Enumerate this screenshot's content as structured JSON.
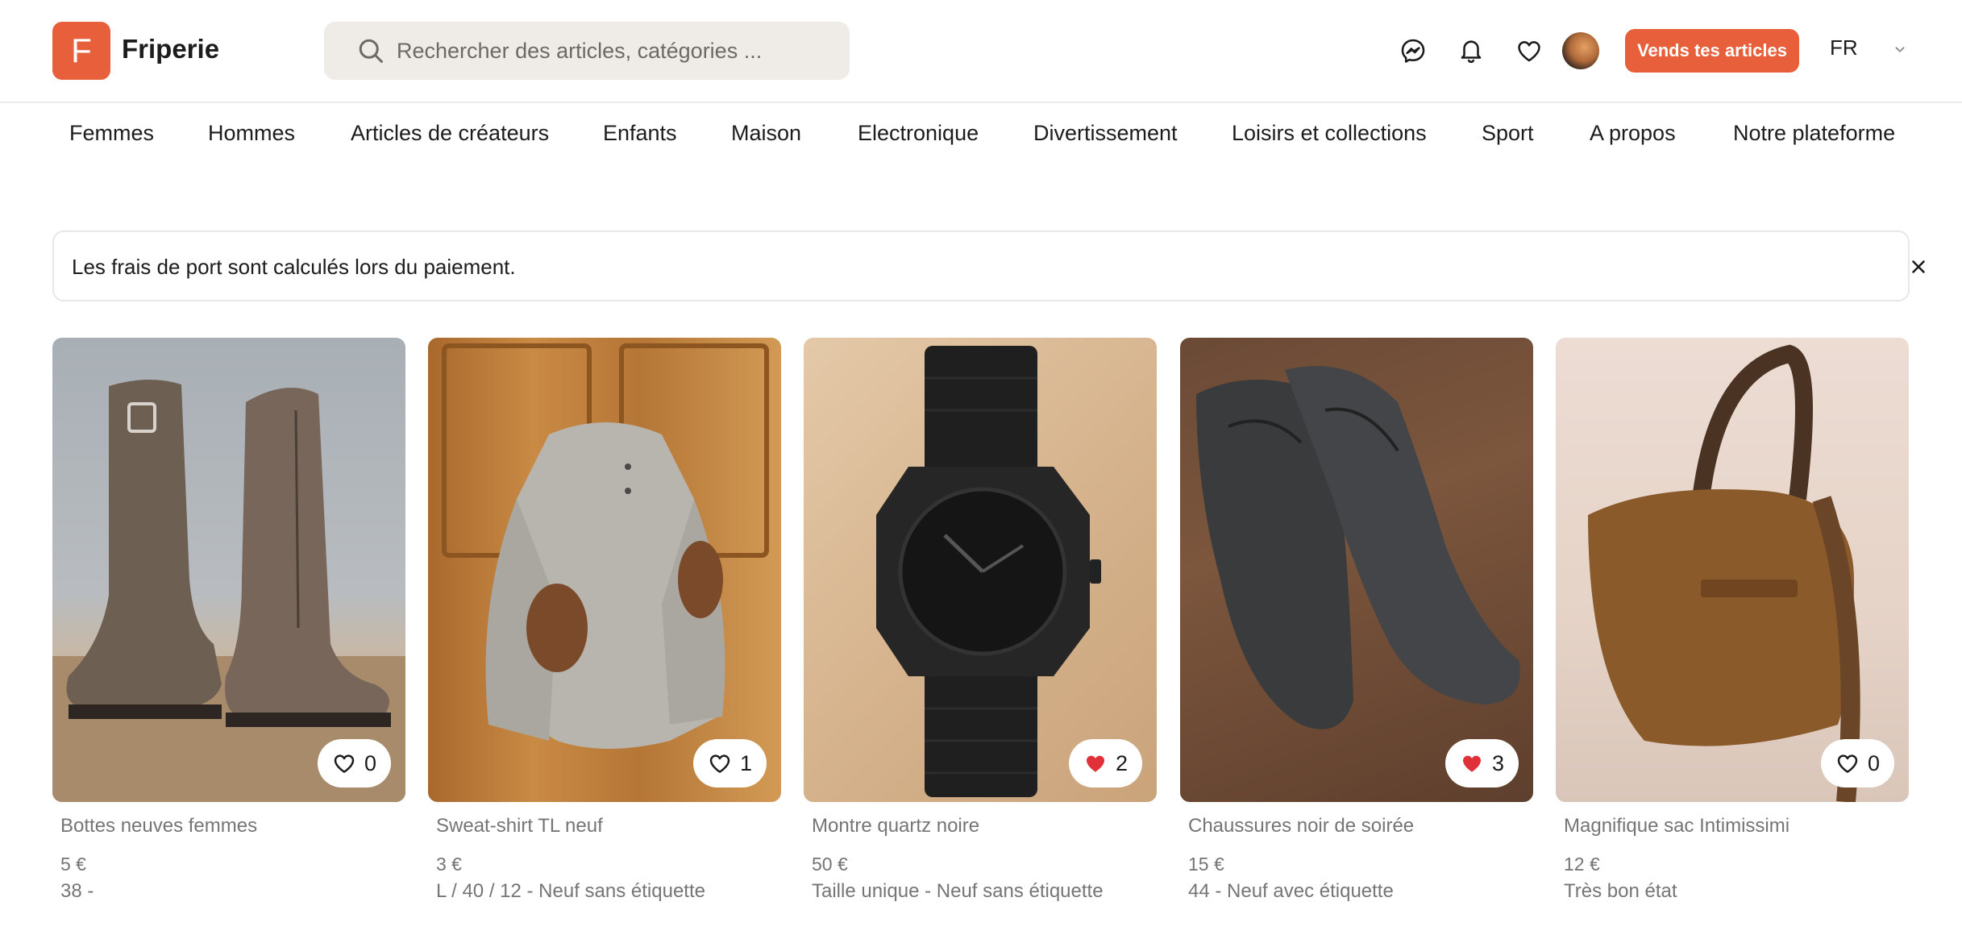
{
  "brand": {
    "logo_letter": "F",
    "name": "Friperie",
    "accent_color": "#e8603b"
  },
  "search": {
    "placeholder": "Rechercher des articles, catégories ..."
  },
  "header": {
    "icons": [
      "messenger-icon",
      "bell-icon",
      "heart-icon"
    ],
    "sell_label": "Vends tes articles",
    "language": "FR"
  },
  "nav": {
    "items": [
      "Femmes",
      "Hommes",
      "Articles de créateurs",
      "Enfants",
      "Maison",
      "Electronique",
      "Divertissement",
      "Loisirs et collections",
      "Sport",
      "A propos",
      "Notre plateforme"
    ]
  },
  "notice": {
    "text": "Les frais de port sont calculés lors du paiement."
  },
  "products": [
    {
      "title": "Bottes neuves femmes",
      "price": "5 €",
      "details": "38 -",
      "likes": "0",
      "liked": false,
      "image": "brown-boots"
    },
    {
      "title": "Sweat-shirt TL neuf",
      "price": "3 €",
      "details": "L / 40 / 12 - Neuf sans étiquette",
      "likes": "1",
      "liked": false,
      "image": "grey-sweatshirt"
    },
    {
      "title": "Montre quartz noire",
      "price": "50 €",
      "details": "Taille unique - Neuf sans étiquette",
      "likes": "2",
      "liked": true,
      "image": "black-watch"
    },
    {
      "title": "Chaussures noir de soirée",
      "price": "15 €",
      "details": "44 - Neuf avec étiquette",
      "likes": "3",
      "liked": true,
      "image": "black-dress-shoes"
    },
    {
      "title": "Magnifique sac Intimissimi",
      "price": "12 €",
      "details": "Très bon état",
      "likes": "0",
      "liked": false,
      "image": "straw-bag"
    }
  ]
}
